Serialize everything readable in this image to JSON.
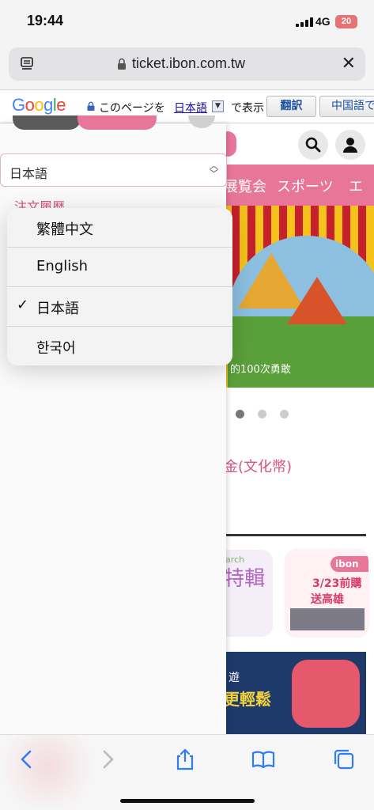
{
  "status": {
    "time": "19:44",
    "network": "4G",
    "battery": "20"
  },
  "address_bar": {
    "url": "ticket.ibon.com.tw"
  },
  "translate_bar": {
    "logo_letters": [
      "G",
      "o",
      "o",
      "g",
      "l",
      "e"
    ],
    "text_prefix": "このページを",
    "language": "日本語",
    "caret": "▼",
    "text_suffix": "で表示",
    "translate_button": "翻訳",
    "chinese_button": "中国語で"
  },
  "sheet": {
    "select_value": "日本語",
    "history_link": "注文履歴"
  },
  "language_menu": {
    "options": [
      {
        "label": "繁體中文",
        "selected": false
      },
      {
        "label": "English",
        "selected": false
      },
      {
        "label": "日本語",
        "selected": true
      },
      {
        "label": "한국어",
        "selected": false
      }
    ],
    "check_glyph": "✓"
  },
  "page": {
    "nav_items": [
      "展覧会",
      "スポーツ",
      "エ"
    ],
    "banner_caption": "的100次勇敢",
    "culture_text": "金(文化幣)",
    "card1_small": "arch",
    "card1_big": "特輯",
    "card2_tag": "ibon",
    "card2_line1": "3/23前購",
    "card2_line2": "送高雄",
    "promo_line1": "遊",
    "promo_line2": "更輕鬆"
  },
  "colors": {
    "brand_pink": "#e8769a",
    "ios_blue": "#2f7cf6"
  },
  "icons": [
    "reader-icon",
    "lock-icon",
    "close-icon",
    "search-icon",
    "user-icon",
    "back-icon",
    "forward-icon",
    "share-icon",
    "bookmarks-icon",
    "tabs-icon"
  ]
}
